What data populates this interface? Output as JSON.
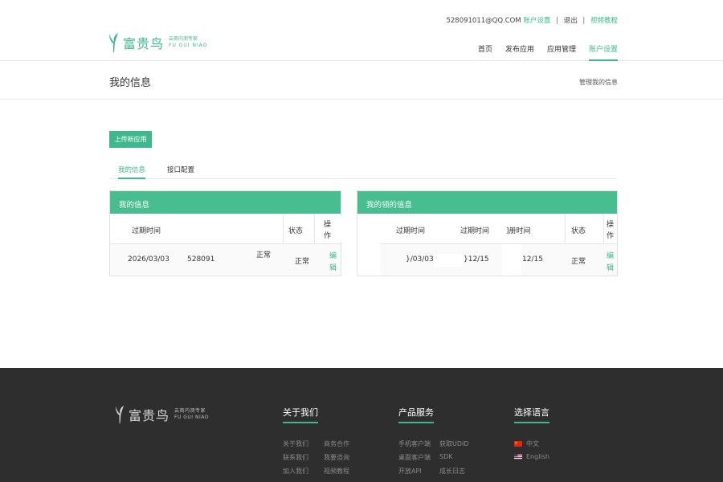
{
  "header": {
    "account": "528091011@QQ.COM",
    "account_settings": "账户设置",
    "logout": "退出",
    "video_tutorial": "视频教程",
    "brand": {
      "name": "富贵鸟",
      "tagline": "云商内测专家",
      "pinyin": "FU GUI NIAO"
    },
    "nav": [
      {
        "label": "首页",
        "active": false
      },
      {
        "label": "发布应用",
        "active": false
      },
      {
        "label": "应用管理",
        "active": false
      },
      {
        "label": "账户设置",
        "active": true
      }
    ]
  },
  "page": {
    "title": "我的信息",
    "breadcrumb": "管理我的信息",
    "upload_button": "上传新应用",
    "tabs": [
      {
        "label": "我的信息",
        "active": true
      },
      {
        "label": "接口配置",
        "active": false
      }
    ]
  },
  "panel_left": {
    "title": "我的信息",
    "headers": [
      "过期时间",
      "状态",
      "操",
      "作"
    ],
    "row": {
      "expire": "2026/03/03",
      "id": "528091",
      "normal_a": "正常",
      "normal_b": "正常",
      "edit_a": "编",
      "edit_b": "辑"
    }
  },
  "panel_right": {
    "title": "我的领的信息",
    "headers": [
      "过期时间",
      "过期时间",
      "]册时间",
      "状态",
      "操",
      "作"
    ],
    "row": {
      "c1": "}/03/03",
      "c2": "}12/15",
      "c3": "12/15",
      "status": "正常",
      "edit_a": "编",
      "edit_b": "辑"
    }
  },
  "footer": {
    "brand": {
      "name": "富贵鸟",
      "tagline": "云商内测专家",
      "pinyin": "FU GUI NIAO"
    },
    "about": {
      "title": "关于我们",
      "links": [
        [
          "关于我们",
          "商务合作"
        ],
        [
          "联系我们",
          "我要咨询"
        ],
        [
          "加入我们",
          "视频教程"
        ]
      ]
    },
    "products": {
      "title": "产品服务",
      "links": [
        [
          "手机客户端",
          "获取UDID"
        ],
        [
          "桌面客户端",
          "SDK"
        ],
        [
          "开放API",
          "成长日志"
        ]
      ]
    },
    "language": {
      "title": "选择语言",
      "options": [
        "中文",
        "English"
      ]
    }
  },
  "colors": {
    "accent": "#3eb98b",
    "footer_bg": "#2e2e2e"
  }
}
